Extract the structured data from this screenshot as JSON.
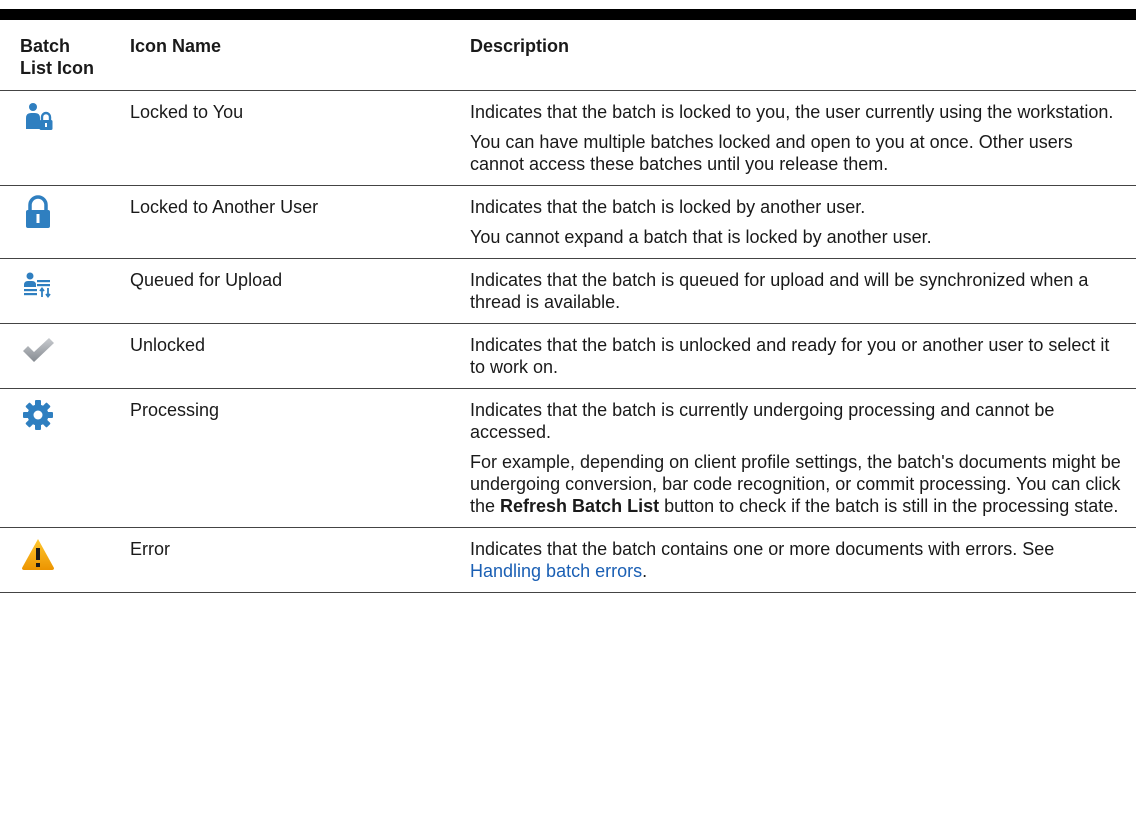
{
  "headers": {
    "icon": "Batch List Icon",
    "name": "Icon Name",
    "description": "Description"
  },
  "rows": [
    {
      "icon": "user-lock-icon",
      "name": "Locked to You",
      "desc": [
        "Indicates that the batch is locked to you, the user currently using the workstation.",
        "You can have multiple batches locked and open to you at once. Other users cannot access these batches until you release them."
      ]
    },
    {
      "icon": "padlock-icon",
      "name": "Locked to Another User",
      "desc": [
        "Indicates that the batch is locked by another user.",
        "You cannot expand a batch that is locked by another user."
      ]
    },
    {
      "icon": "queued-upload-icon",
      "name": "Queued for Upload",
      "desc": [
        "Indicates that the batch is queued for upload and will be synchronized when a thread is available."
      ]
    },
    {
      "icon": "checkmark-icon",
      "name": "Unlocked",
      "desc": [
        "Indicates that the batch is unlocked and ready for you or another user to select it to work on."
      ]
    },
    {
      "icon": "gear-icon",
      "name": "Processing",
      "desc": [
        "Indicates that the batch is currently undergoing processing and cannot be accessed."
      ],
      "desc2": {
        "before": "For example, depending on client profile settings, the batch's documents might be undergoing conversion, bar code recognition, or commit processing. You can click the ",
        "bold": "Refresh Batch List",
        "after": " button to check if the batch is still in the processing state."
      }
    },
    {
      "icon": "warning-icon",
      "name": "Error",
      "error_desc": {
        "before": "Indicates that the batch contains one or more documents with errors. See ",
        "link": "Handling batch errors",
        "after": "."
      }
    }
  ],
  "colors": {
    "icon_blue": "#2f7fc0",
    "check_gray": "#9aa0a6",
    "warning_orange": "#f0a000",
    "link_blue": "#1a5fb4"
  }
}
